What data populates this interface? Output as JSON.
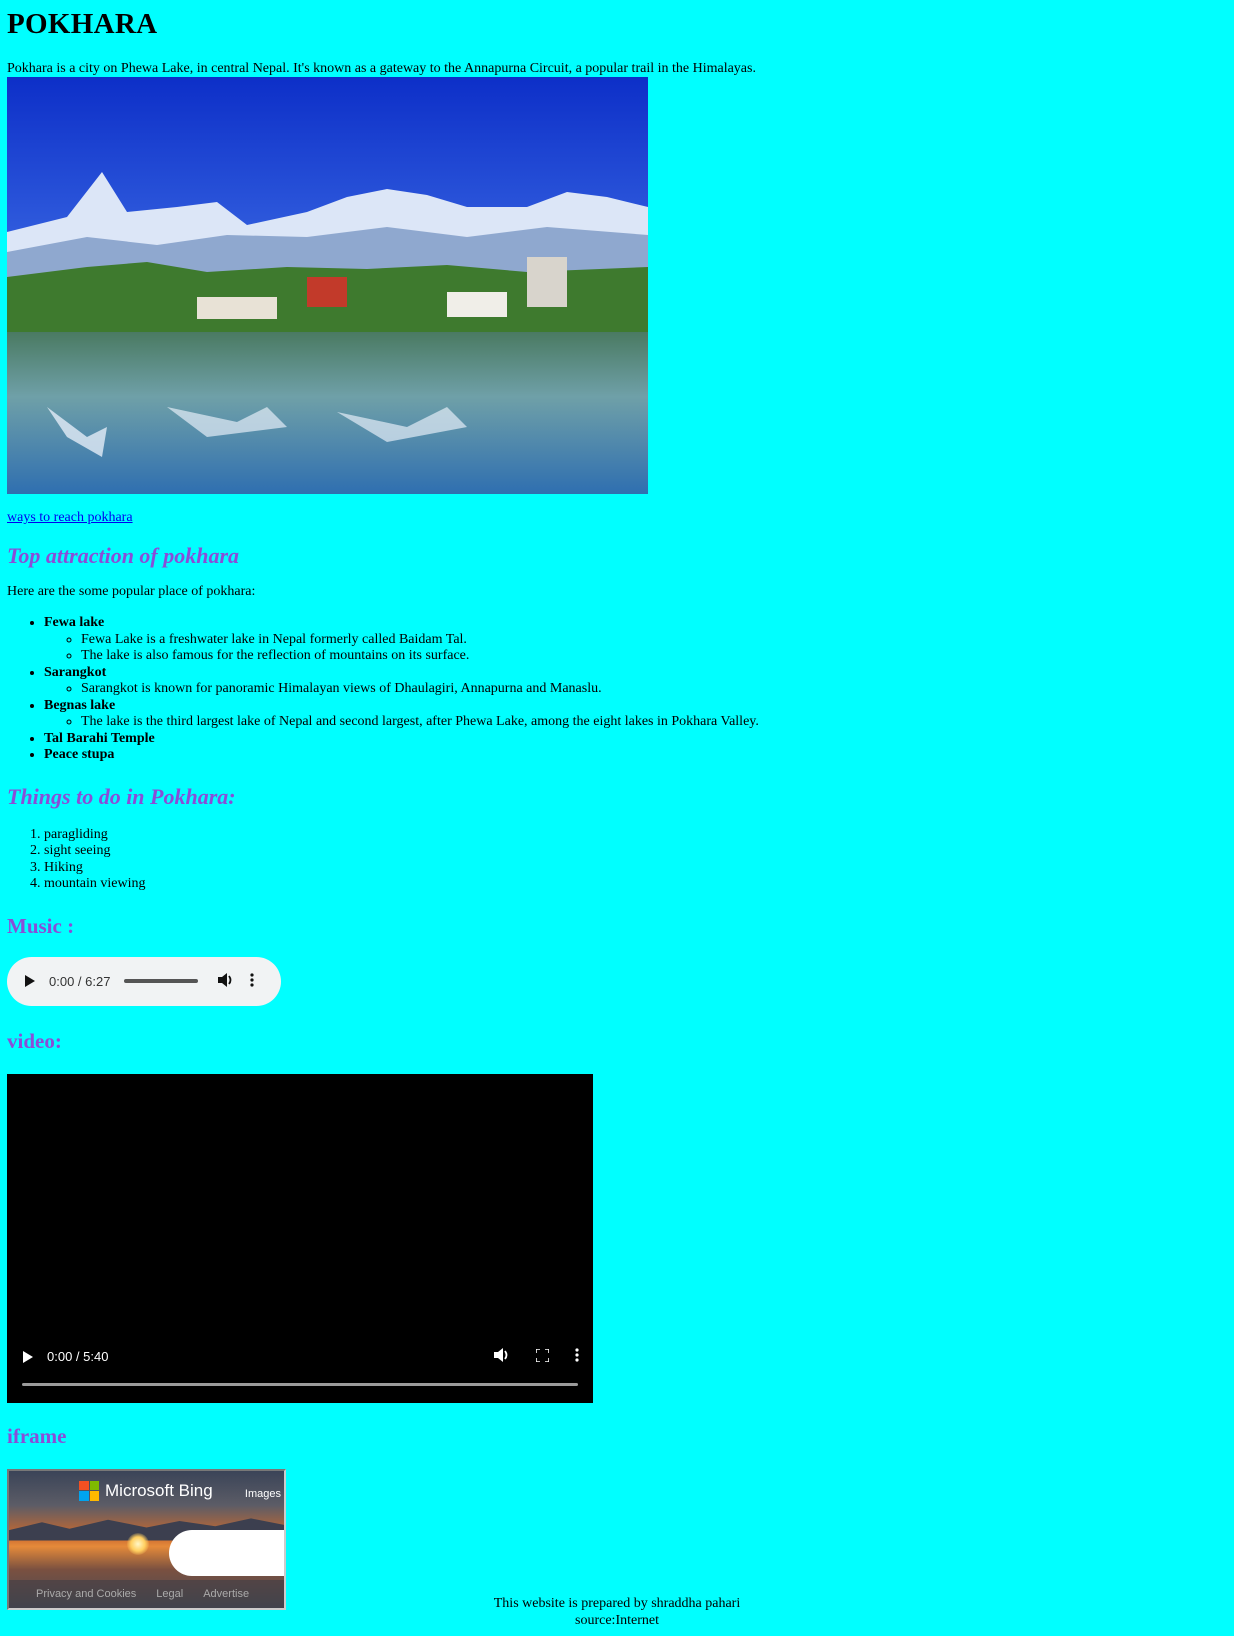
{
  "page": {
    "title": "POKHARA",
    "intro": "Pokhara is a city on Phewa Lake, in central Nepal. It's known as a gateway to the Annapurna Circuit, a popular trail in the Himalayas.",
    "reach_link": "ways to reach pokhara"
  },
  "attractions": {
    "heading": "Top attraction of pokhara",
    "intro": "Here are the some popular place of pokhara:",
    "places": [
      {
        "name": "Fewa lake",
        "details": [
          "Fewa Lake is a freshwater lake in Nepal formerly called Baidam Tal.",
          "The lake is also famous for the reflection of mountains on its surface."
        ]
      },
      {
        "name": "Sarangkot",
        "details": [
          "Sarangkot is known for panoramic Himalayan views of Dhaulagiri, Annapurna and Manaslu."
        ]
      },
      {
        "name": "Begnas lake",
        "details": [
          "The lake is the third largest lake of Nepal and second largest, after Phewa Lake, among the eight lakes in Pokhara Valley."
        ]
      },
      {
        "name": "Tal Barahi Temple",
        "details": []
      },
      {
        "name": "Peace stupa",
        "details": []
      }
    ]
  },
  "todo": {
    "heading": "Things to do in Pokhara:",
    "items": [
      "paragliding",
      "sight seeing",
      "Hiking",
      "mountain viewing"
    ]
  },
  "music": {
    "heading": "Music :",
    "time": "0:00 / 6:27",
    "progress": 0
  },
  "video": {
    "heading": "video:",
    "time": "0:00 / 5:40",
    "progress": 0
  },
  "iframe": {
    "heading": "iframe",
    "brand": "Microsoft Bing",
    "images_label": "Images",
    "footer_links": [
      "Privacy and Cookies",
      "Legal",
      "Advertise"
    ]
  },
  "footer": {
    "credit": "This website is prepared by shraddha pahari",
    "source": "source:Internet"
  },
  "colors": {
    "background": "#00ffff",
    "heading": "#8a4dd8",
    "link": "#0000ee"
  }
}
